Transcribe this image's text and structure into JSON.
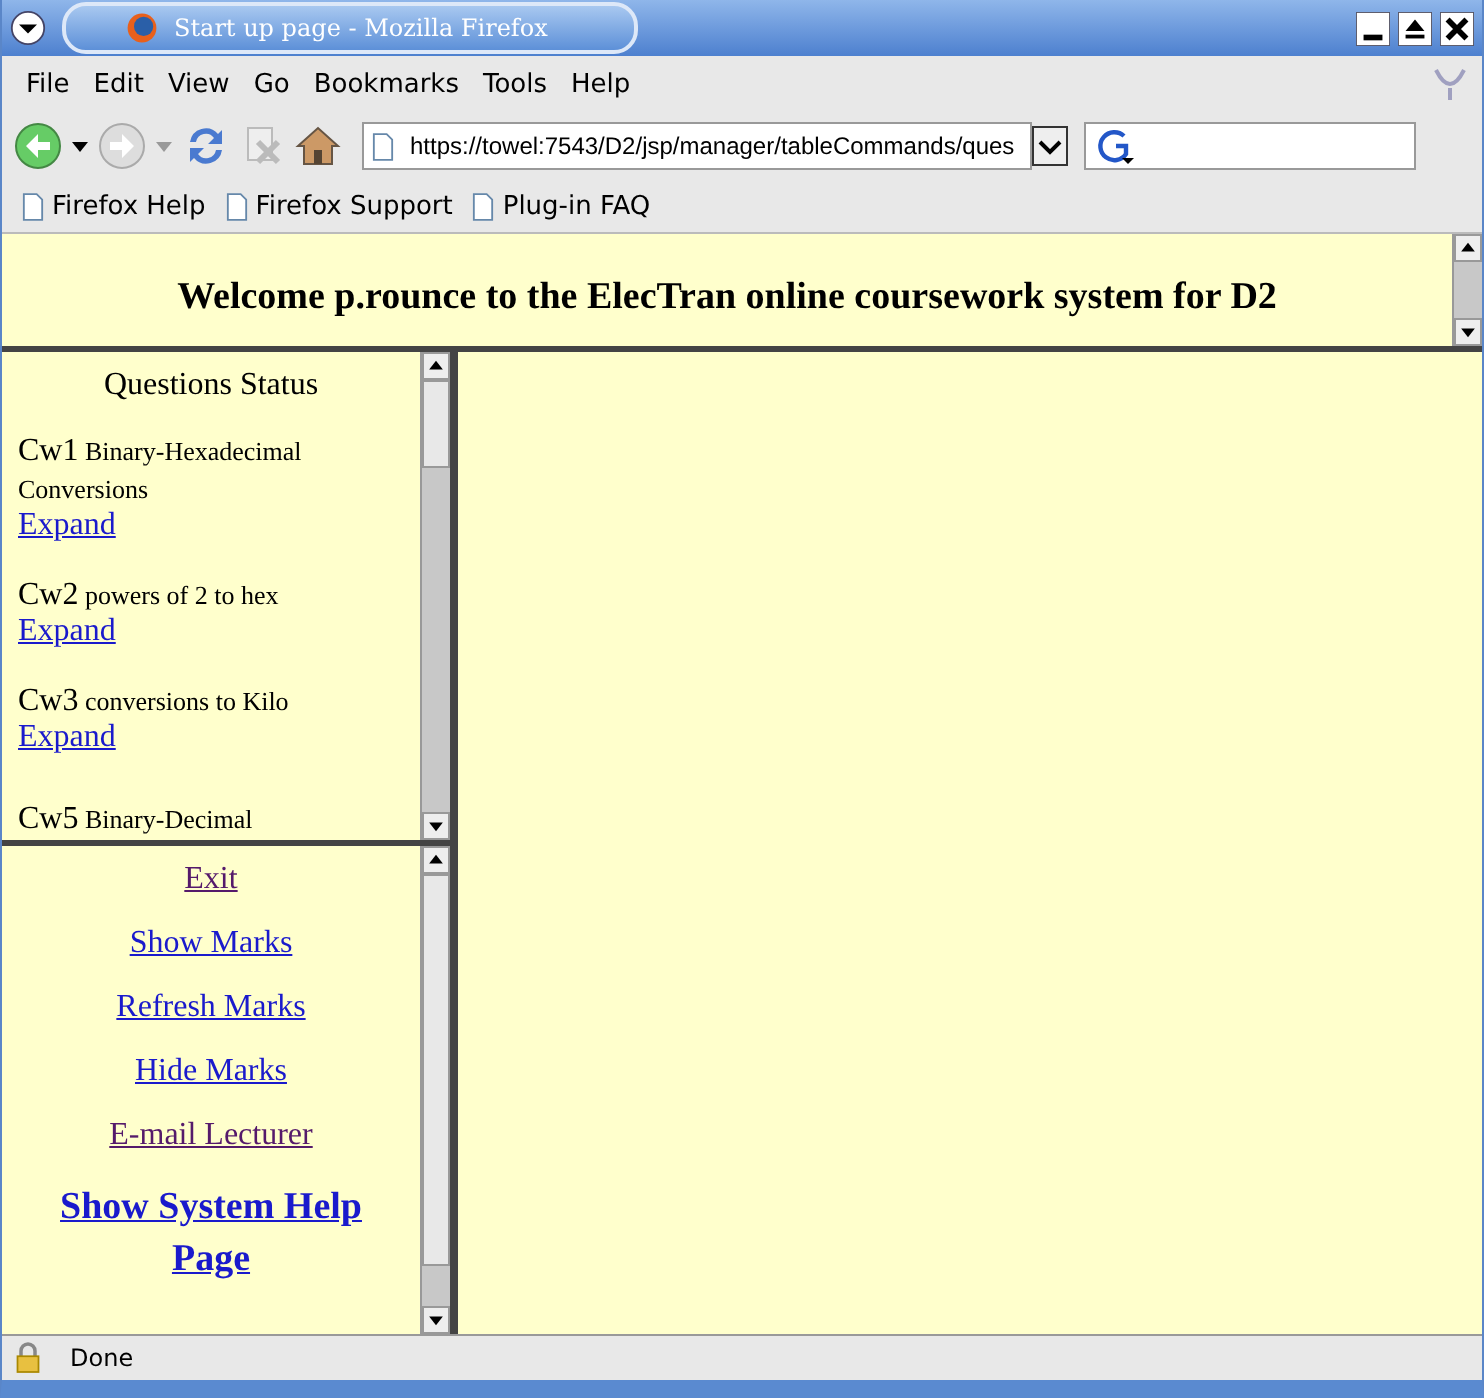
{
  "window": {
    "title": "Start up page - Mozilla Firefox"
  },
  "menu": [
    "File",
    "Edit",
    "View",
    "Go",
    "Bookmarks",
    "Tools",
    "Help"
  ],
  "address": {
    "value": "https://towel:7543/D2/jsp/manager/tableCommands/ques"
  },
  "bookmarks": [
    "Firefox Help",
    "Firefox Support",
    "Plug-in FAQ"
  ],
  "header": {
    "text": "Welcome p.rounce to the ElecTran online coursework system for D2"
  },
  "questions": {
    "title": "Questions Status",
    "items": [
      {
        "code": "Cw1",
        "name": "Binary-Hexadecimal Conversions",
        "link": "Expand"
      },
      {
        "code": "Cw2",
        "name": "powers of 2 to hex",
        "link": "Expand"
      },
      {
        "code": "Cw3",
        "name": "conversions to Kilo",
        "link": "Expand"
      },
      {
        "code": "Cw5",
        "name": "Binary-Decimal"
      }
    ]
  },
  "commands": [
    {
      "label": "Exit",
      "visited": true,
      "kind": "normal"
    },
    {
      "label": "Show Marks",
      "visited": false,
      "kind": "normal"
    },
    {
      "label": "Refresh Marks",
      "visited": false,
      "kind": "normal"
    },
    {
      "label": "Hide Marks",
      "visited": false,
      "kind": "normal"
    },
    {
      "label": "E-mail Lecturer",
      "visited": true,
      "kind": "normal"
    },
    {
      "label": "Show System Help Page",
      "visited": false,
      "kind": "big"
    }
  ],
  "status_bar": {
    "text": "Done"
  }
}
